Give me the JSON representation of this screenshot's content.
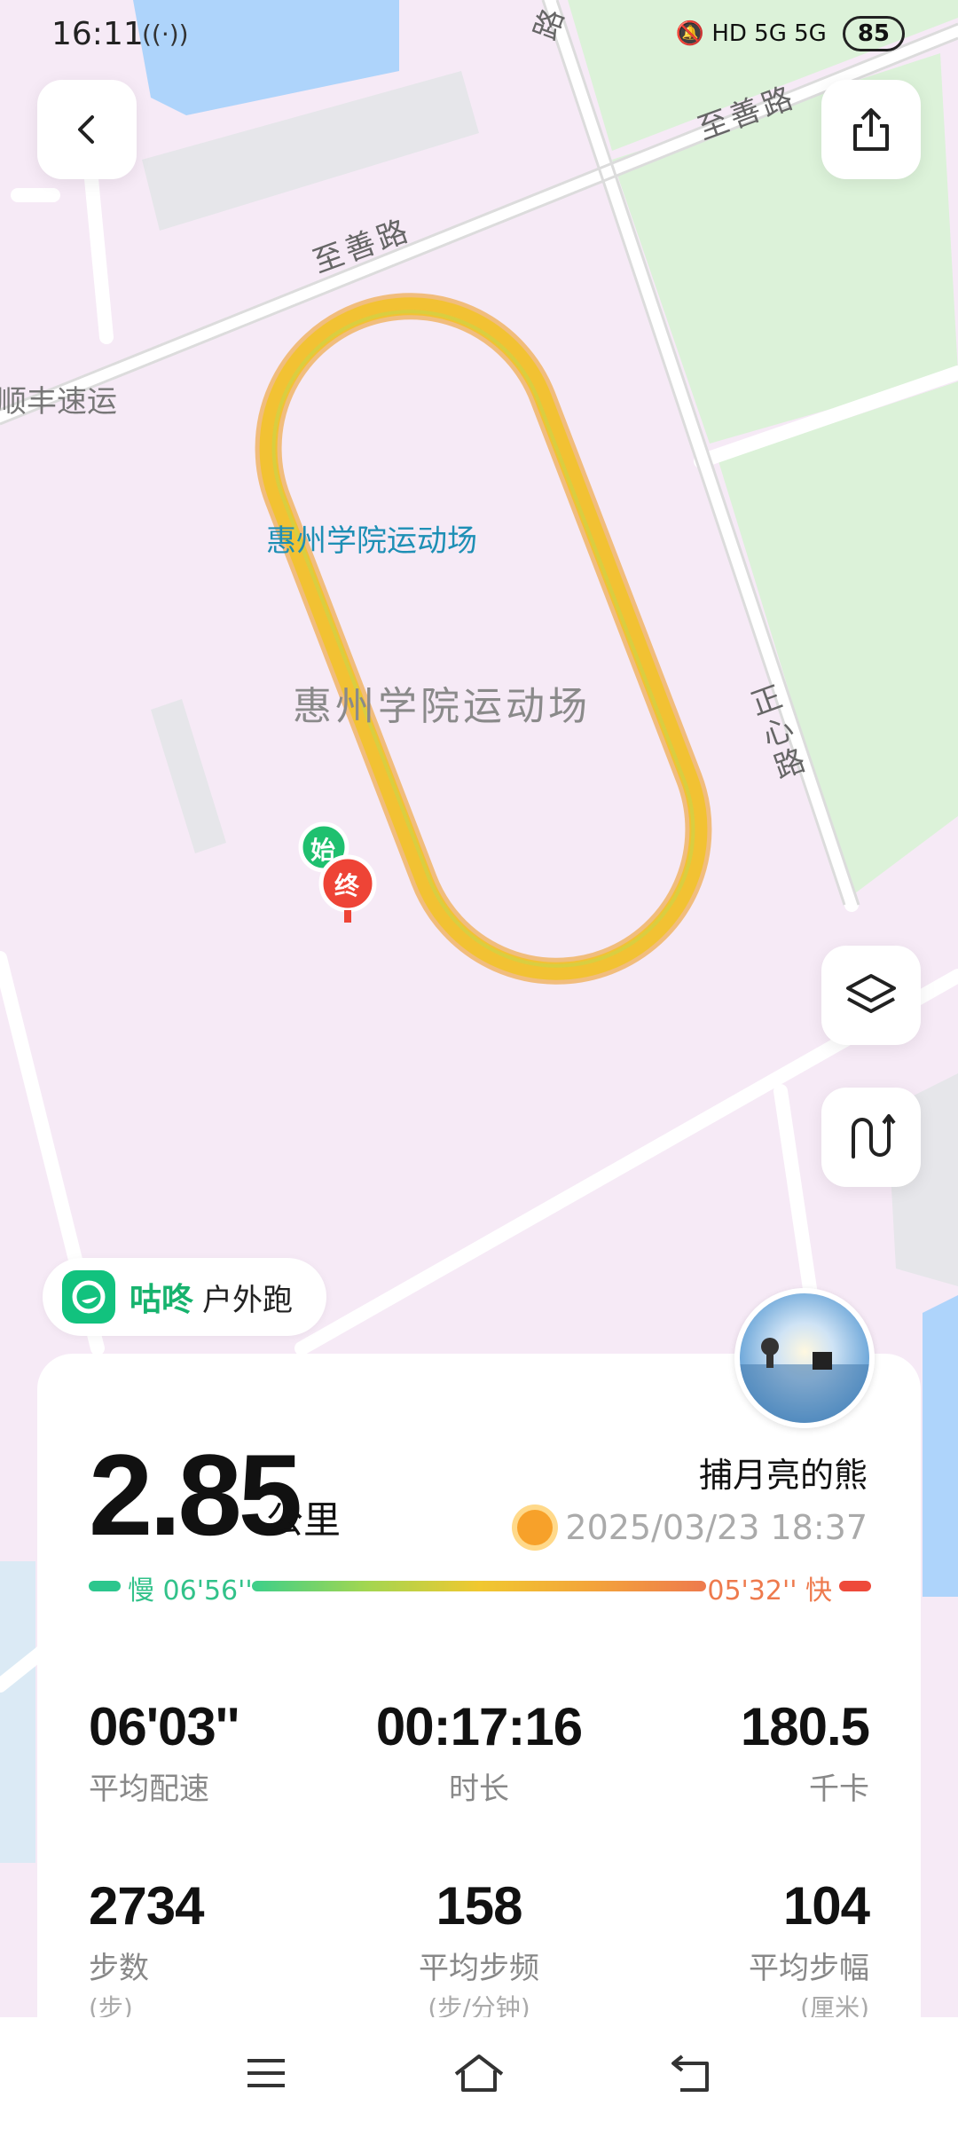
{
  "status_bar": {
    "time": "16:11",
    "network_left": "((·))",
    "right_icons": "🔕 HD 5G 5G",
    "battery": "85"
  },
  "map": {
    "roads": [
      "至善路",
      "至善路",
      "正心路",
      "路"
    ],
    "pois": [
      "顺丰速运",
      "惠州学院运动场",
      "惠州学院运动场"
    ],
    "start_label": "始",
    "end_label": "终",
    "track_color": "#f2b531"
  },
  "brand": {
    "name": "咕咚",
    "activity": "户外跑"
  },
  "summary": {
    "distance": "2.85",
    "distance_unit": "公里",
    "username": "捕月亮的熊",
    "datetime": "2025/03/23 18:37",
    "pace_slow": "慢 06'56''",
    "pace_fast": "05'32'' 快"
  },
  "stats": [
    {
      "value": "06'03''",
      "label": "平均配速",
      "sub": ""
    },
    {
      "value": "00:17:16",
      "label": "时长",
      "sub": ""
    },
    {
      "value": "180.5",
      "label": "千卡",
      "sub": ""
    },
    {
      "value": "2734",
      "label": "步数",
      "sub": "(步)"
    },
    {
      "value": "158",
      "label": "平均步频",
      "sub": "(步/分钟)"
    },
    {
      "value": "104",
      "label": "平均步幅",
      "sub": "(厘米)"
    }
  ],
  "colors": {
    "brand_green": "#17b36e",
    "map_bg": "#f6eaf6",
    "park_green": "#d9f2d6"
  }
}
